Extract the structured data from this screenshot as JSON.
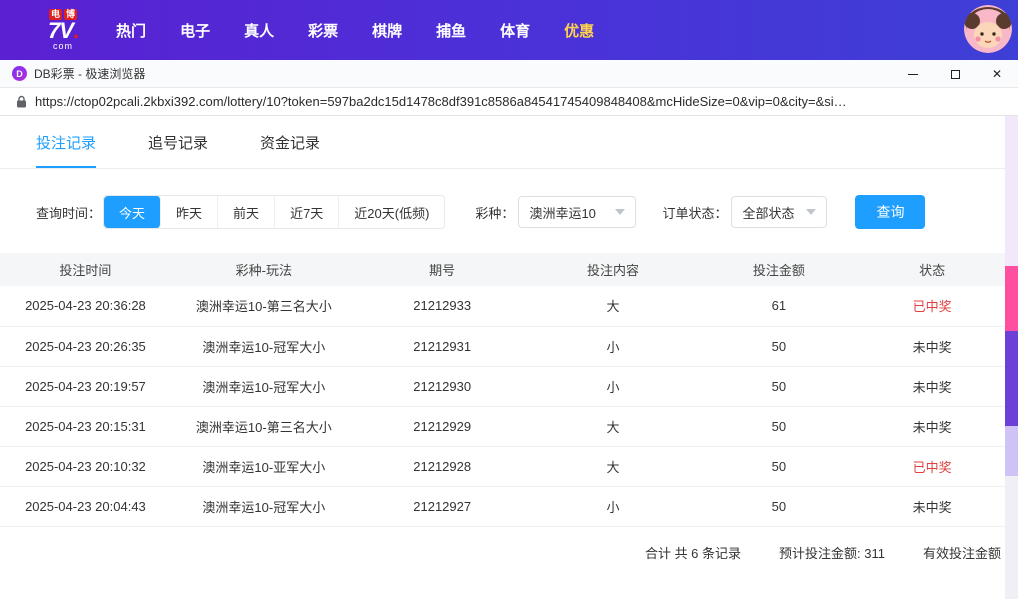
{
  "topnav": {
    "logo": {
      "badge1": "电",
      "badge2": "博",
      "main": "7V",
      "dot": ".",
      "sub": "com"
    },
    "items": [
      {
        "label": "热门",
        "highlight": false
      },
      {
        "label": "电子",
        "highlight": false
      },
      {
        "label": "真人",
        "highlight": false
      },
      {
        "label": "彩票",
        "highlight": false
      },
      {
        "label": "棋牌",
        "highlight": false
      },
      {
        "label": "捕鱼",
        "highlight": false
      },
      {
        "label": "体育",
        "highlight": false
      },
      {
        "label": "优惠",
        "highlight": true
      }
    ]
  },
  "window": {
    "favicon_letter": "D",
    "title": "DB彩票 - 极速浏览器"
  },
  "address_bar": {
    "url": "https://ctop02pcali.2kbxi392.com/lottery/10?token=597ba2dc15d1478c8df391c8586a84541745409848408&mcHideSize=0&vip=0&city=&si…"
  },
  "tabs": [
    {
      "label": "投注记录",
      "active": true
    },
    {
      "label": "追号记录",
      "active": false
    },
    {
      "label": "资金记录",
      "active": false
    }
  ],
  "filters": {
    "time_label": "查询时间：",
    "time_options": [
      "今天",
      "昨天",
      "前天",
      "近7天",
      "近20天(低频)"
    ],
    "time_active": "今天",
    "lottery_label": "彩种：",
    "lottery_value": "澳洲幸运10",
    "status_label": "订单状态：",
    "status_value": "全部状态",
    "search_button": "查询"
  },
  "table": {
    "headers": [
      "投注时间",
      "彩种-玩法",
      "期号",
      "投注内容",
      "投注金额",
      "状态"
    ],
    "columns": [
      "time",
      "play",
      "issue",
      "content",
      "amount",
      "status"
    ],
    "rows": [
      {
        "time": "2025-04-23 20:36:28",
        "play": "澳洲幸运10-第三名大小",
        "issue": "21212933",
        "content": "大",
        "amount": "61",
        "status": "已中奖",
        "won": true
      },
      {
        "time": "2025-04-23 20:26:35",
        "play": "澳洲幸运10-冠军大小",
        "issue": "21212931",
        "content": "小",
        "amount": "50",
        "status": "未中奖",
        "won": false
      },
      {
        "time": "2025-04-23 20:19:57",
        "play": "澳洲幸运10-冠军大小",
        "issue": "21212930",
        "content": "小",
        "amount": "50",
        "status": "未中奖",
        "won": false
      },
      {
        "time": "2025-04-23 20:15:31",
        "play": "澳洲幸运10-第三名大小",
        "issue": "21212929",
        "content": "大",
        "amount": "50",
        "status": "未中奖",
        "won": false
      },
      {
        "time": "2025-04-23 20:10:32",
        "play": "澳洲幸运10-亚军大小",
        "issue": "21212928",
        "content": "大",
        "amount": "50",
        "status": "已中奖",
        "won": true
      },
      {
        "time": "2025-04-23 20:04:43",
        "play": "澳洲幸运10-冠军大小",
        "issue": "21212927",
        "content": "小",
        "amount": "50",
        "status": "未中奖",
        "won": false
      }
    ]
  },
  "summary": {
    "total": "合计 共 6 条记录",
    "expected": "预计投注金额: 311",
    "valid": "有效投注金额"
  },
  "colors": {
    "accent": "#1e9fff",
    "won_status": "#e0403f",
    "nav_highlight": "#ffd24a"
  }
}
